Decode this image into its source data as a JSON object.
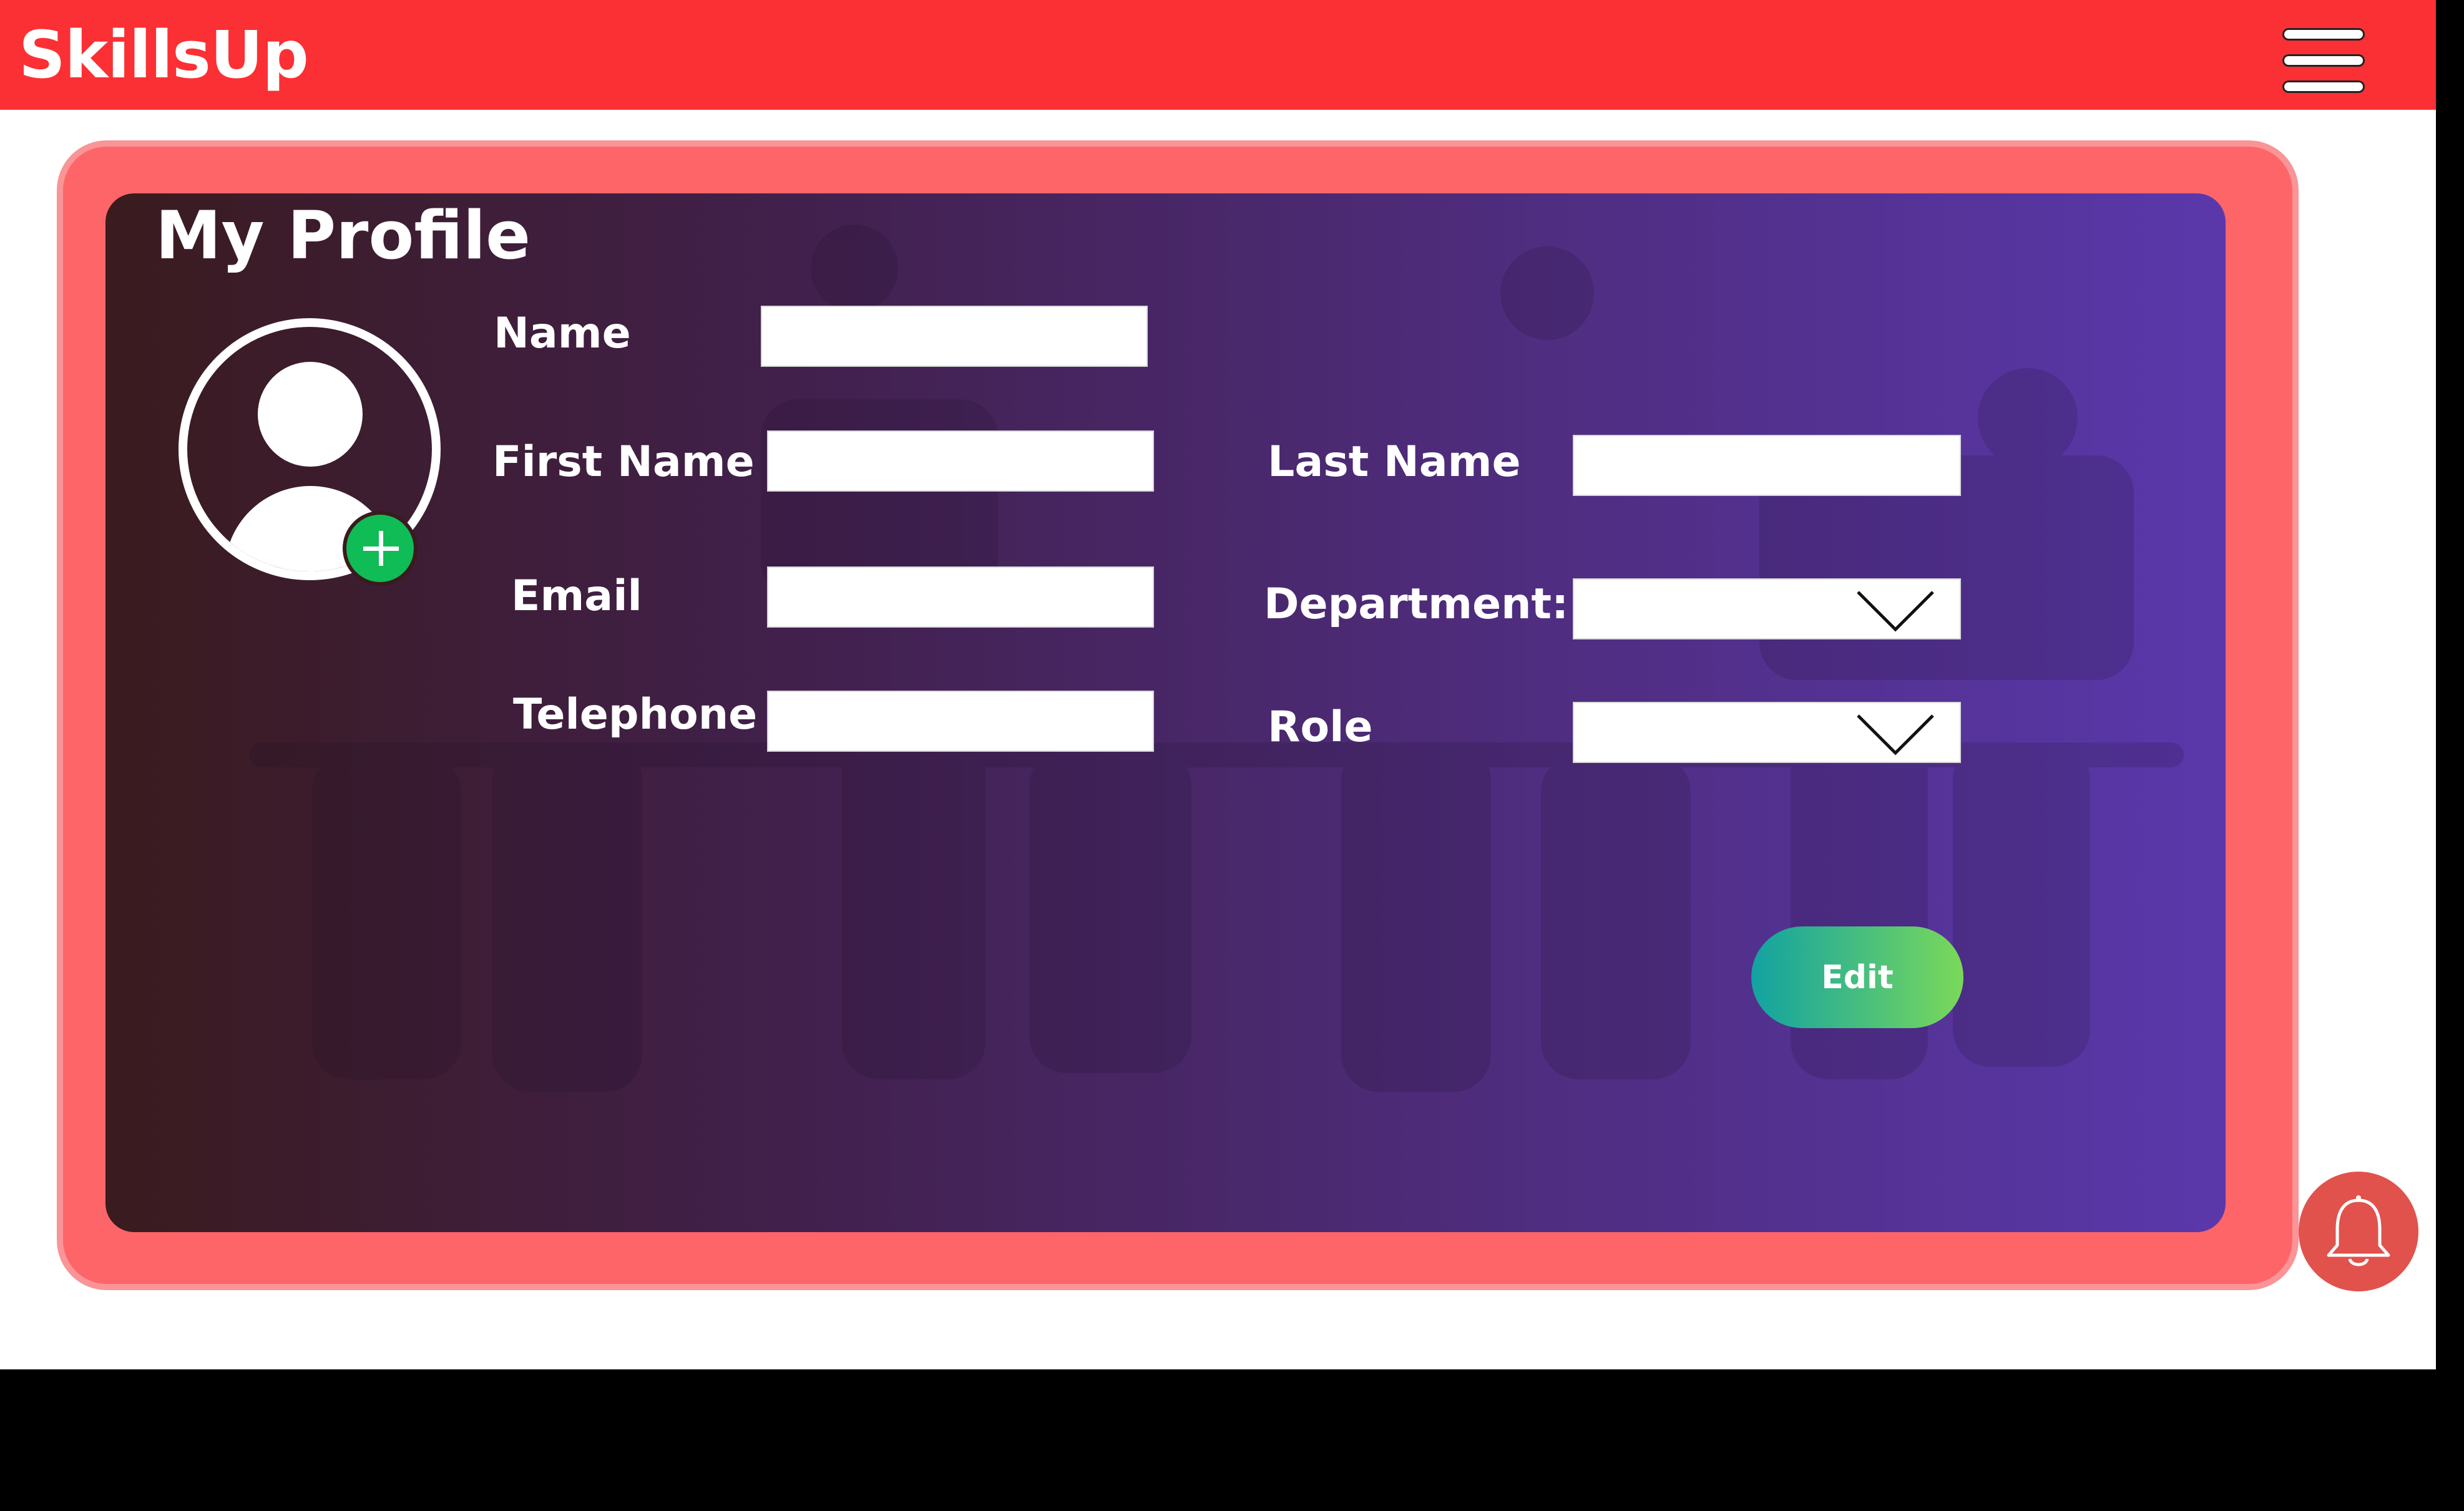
{
  "header": {
    "app_title": "SkillsUp",
    "menu_icon": "hamburger-menu-icon"
  },
  "profile": {
    "title": "My Profile",
    "avatar_icon": "user-avatar-icon",
    "add_photo_icon": "plus-icon",
    "fields": {
      "name": {
        "label": "Name",
        "value": ""
      },
      "first_name": {
        "label": "First Name",
        "value": ""
      },
      "last_name": {
        "label": "Last Name",
        "value": ""
      },
      "email": {
        "label": "Email",
        "value": ""
      },
      "department": {
        "label": "Department:",
        "value": ""
      },
      "telephone": {
        "label": "Telephone",
        "value": ""
      },
      "role": {
        "label": "Role",
        "value": ""
      }
    },
    "edit_label": "Edit"
  },
  "notifications": {
    "icon": "bell-icon"
  },
  "colors": {
    "header": "#fb3034",
    "panel": "#fe6569",
    "card_start": "#3a1b1e",
    "card_end": "#5a38ab",
    "add_button": "#10bc55",
    "bell_button": "#e1524c"
  }
}
